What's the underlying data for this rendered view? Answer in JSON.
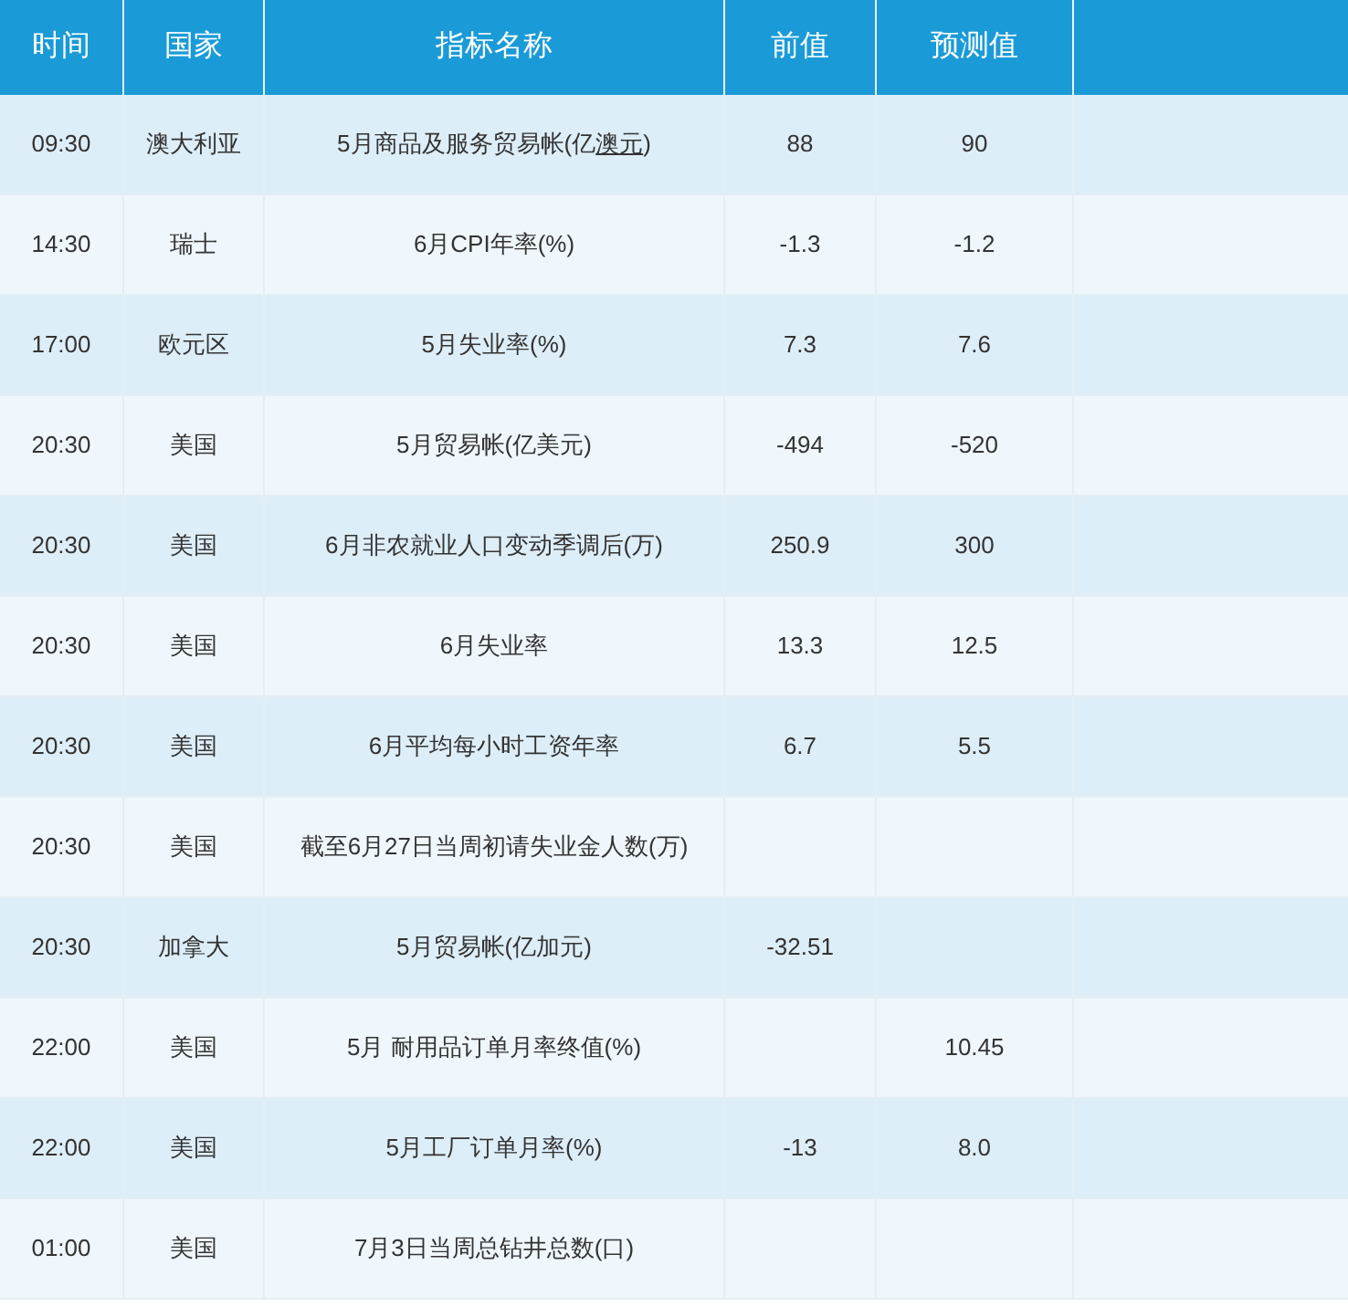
{
  "columns": [
    "时间",
    "国家",
    "指标名称",
    "前值",
    "预测值"
  ],
  "rows": [
    {
      "time": "09:30",
      "country": "澳大利亚",
      "indicator": "5月商品及服务贸易帐(亿",
      "link": "澳元",
      "suffix": ")",
      "previous": "88",
      "forecast": "90"
    },
    {
      "time": "14:30",
      "country": "瑞士",
      "indicator": "6月CPI年率(%)",
      "previous": "-1.3",
      "forecast": "-1.2"
    },
    {
      "time": "17:00",
      "country": "欧元区",
      "indicator": "5月失业率(%)",
      "previous": "7.3",
      "forecast": "7.6"
    },
    {
      "time": "20:30",
      "country": "美国",
      "indicator": "5月贸易帐(亿美元)",
      "previous": "-494",
      "forecast": "-520"
    },
    {
      "time": "20:30",
      "country": "美国",
      "indicator": "6月非农就业人口变动季调后(万)",
      "previous": "250.9",
      "forecast": "300"
    },
    {
      "time": "20:30",
      "country": "美国",
      "indicator": "6月失业率",
      "previous": "13.3",
      "forecast": "12.5"
    },
    {
      "time": "20:30",
      "country": "美国",
      "indicator": "6月平均每小时工资年率",
      "previous": "6.7",
      "forecast": "5.5"
    },
    {
      "time": "20:30",
      "country": "美国",
      "indicator": "截至6月27日当周初请失业金人数(万)"
    },
    {
      "time": "20:30",
      "country": "加拿大",
      "indicator": "5月贸易帐(亿加元)",
      "previous": "-32.51"
    },
    {
      "time": "22:00",
      "country": "美国",
      "indicator": "5月 耐用品订单月率终值(%)",
      "forecast": "10.45"
    },
    {
      "time": "22:00",
      "country": "美国",
      "indicator": "5月工厂订单月率(%)",
      "previous": "-13",
      "forecast": "8.0"
    },
    {
      "time": "01:00",
      "country": "美国",
      "indicator": "7月3日当周总钻井总数(口)"
    }
  ]
}
